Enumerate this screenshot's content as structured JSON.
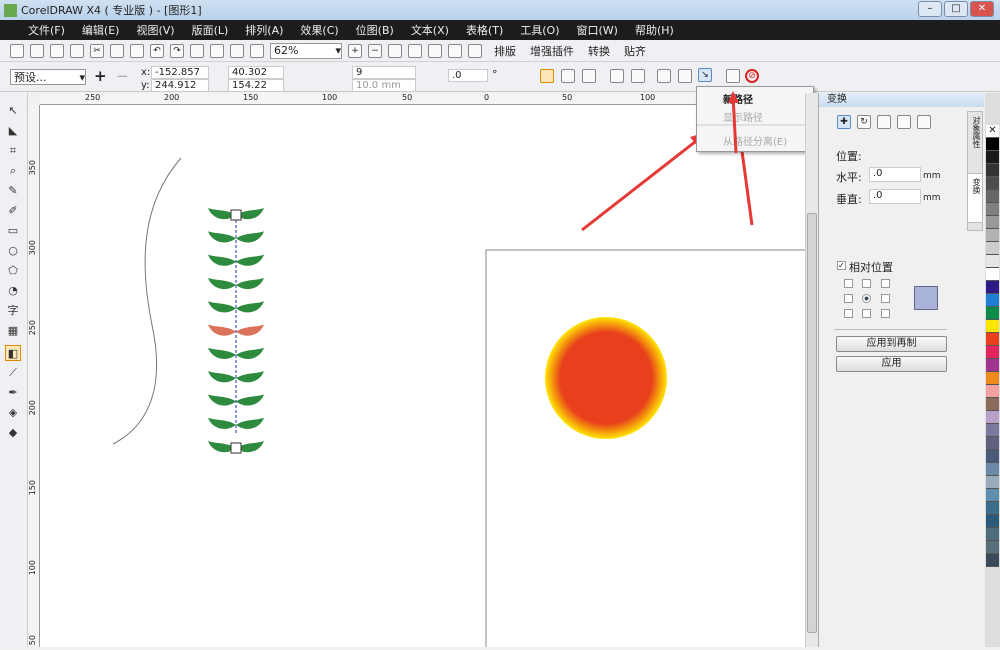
{
  "window": {
    "title": "CorelDRAW X4 ( 专业版 ) - [图形1]",
    "min": "–",
    "max": "□",
    "close": "✕"
  },
  "menubar": [
    "文件(F)",
    "编辑(E)",
    "视图(V)",
    "版面(L)",
    "排列(A)",
    "效果(C)",
    "位图(B)",
    "文本(X)",
    "表格(T)",
    "工具(O)",
    "窗口(W)",
    "帮助(H)"
  ],
  "toolbar": {
    "zoom": "62%",
    "plugins": [
      "排版",
      "增强插件",
      "转换",
      "贴齐"
    ]
  },
  "propbar": {
    "preset": "预设...",
    "x": "-152.857 mm",
    "y": "244.912 mm",
    "w": "40.302 mm",
    "h": "154.22 mm",
    "x_label": "x:",
    "y_label": "y:",
    "steps": "9",
    "spacing": "10.0 mm",
    "rotation": ".0",
    "degree": "°"
  },
  "rulers": {
    "h": [
      "250",
      "200",
      "150",
      "100",
      "50",
      "0",
      "50",
      "100"
    ],
    "v": [
      "350",
      "300",
      "250",
      "200",
      "150",
      "100",
      "50"
    ]
  },
  "context_menu": {
    "items": [
      {
        "label": "新路径",
        "enabled": true
      },
      {
        "label": "显示路径",
        "enabled": false
      },
      {
        "label": "从路径分离(E)",
        "enabled": false
      }
    ]
  },
  "docker": {
    "title": "变换",
    "position_label": "位置:",
    "h_label": "水平:",
    "h_value": ".0",
    "v_label": "垂直:",
    "v_value": ".0",
    "unit": "mm",
    "relative_label": "相对位置",
    "relative_checked": true,
    "apply_dup": "应用到再制",
    "apply": "应用",
    "tabs": [
      "对象属性",
      "变换"
    ]
  },
  "palette": [
    "#000000",
    "#1a1a1a",
    "#333333",
    "#4d4d4d",
    "#666666",
    "#808080",
    "#999999",
    "#b3b3b3",
    "#cccccc",
    "#e6e6e6",
    "#ffffff",
    "#2e1a87",
    "#1f7fd6",
    "#0b8a4a",
    "#ffe600",
    "#e8401c",
    "#e3245f",
    "#a0348f",
    "#f08a1e",
    "#f5a0a0",
    "#8c6b5a",
    "#b8a0c8",
    "#7a7aa0",
    "#606080",
    "#4a5a7a",
    "#6a8aa8",
    "#9ab",
    "#5f8faf",
    "#3d6d8d",
    "#2a5a7a",
    "#4d6d7d",
    "#58707a",
    "#3a4a5a"
  ],
  "colors": {
    "accent": "#e8401c",
    "leaf": "#2e8b3e",
    "arrow": "#e53935"
  }
}
